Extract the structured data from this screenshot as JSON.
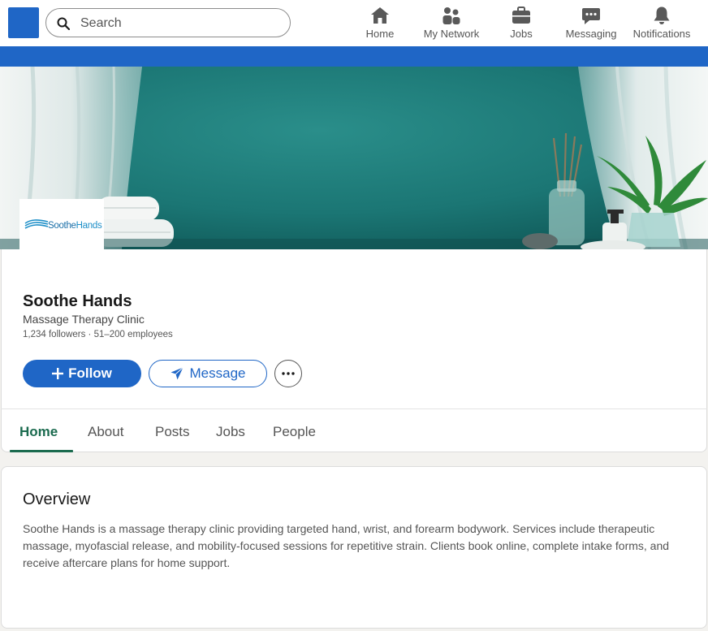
{
  "nav": {
    "search_placeholder": "Search",
    "items": [
      {
        "label": "Home",
        "icon": "home-icon"
      },
      {
        "label": "My Network",
        "icon": "people-icon"
      },
      {
        "label": "Jobs",
        "icon": "briefcase-icon"
      },
      {
        "label": "Messaging",
        "icon": "chat-icon"
      },
      {
        "label": "Notifications",
        "icon": "bell-icon"
      }
    ]
  },
  "company": {
    "logo_text_a": "Soothe",
    "logo_text_b": "Hands",
    "name": "Soothe Hands",
    "industry": "Massage Therapy Clinic",
    "meta": "1,234 followers · 51–200 employees"
  },
  "actions": {
    "follow_label": "Follow",
    "message_label": "Message"
  },
  "tabs": [
    "Home",
    "About",
    "Posts",
    "Jobs",
    "People"
  ],
  "overview": {
    "title": "Overview",
    "body": "Soothe Hands is a massage therapy clinic providing targeted hand, wrist, and forearm bodywork. Services include therapeutic massage, myofascial release, and mobility-focused sessions for repetitive strain. Clients book online, complete intake forms, and receive aftercare plans for home support."
  },
  "colors": {
    "brand_blue": "#1f66c6",
    "tab_active": "#1b6b4f",
    "cover_teal": "#1b7b79"
  }
}
